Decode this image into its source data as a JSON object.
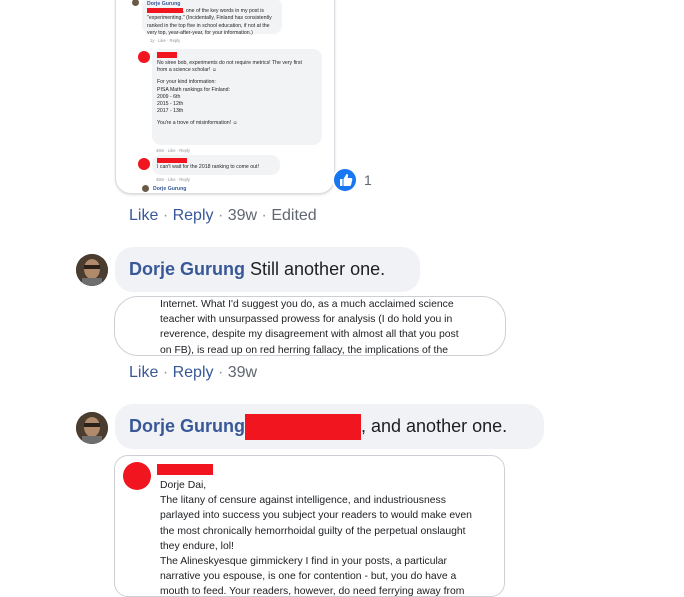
{
  "comment1": {
    "screenshot": {
      "entry1": {
        "name": "Dorje Gurung",
        "text_after_redaction": ", one of the key words in my post is",
        "text_rest": "\"experimenting.\" (Incidentally, Finland has consistently ranked in the top five in school education, if not at the very top, year-after-year, for your information.)",
        "actions": "1y · Like · Reply"
      },
      "entry2": {
        "lines": [
          "No siree bob, experiments do not require metrics! The very first",
          "from a science scholar! ☺",
          "",
          "For your kind information:",
          "PISA Math rankings for Finland:",
          "2009 - 6th",
          "2015 - 12th",
          "2017 - 13th",
          "",
          "You're a trove of misinformation! ☺"
        ],
        "actions": "48m · Like · Reply"
      },
      "entry3": {
        "text": "I can't wait for the 2018 ranking to come out!",
        "actions": "48m · Like · Reply"
      },
      "entry4": {
        "name": "Dorje Gurung"
      }
    },
    "reaction_count": "1",
    "actions": {
      "like": "Like",
      "reply": "Reply",
      "time": "39w",
      "edited": "Edited"
    }
  },
  "comment2": {
    "author": "Dorje Gurung",
    "text": "Still another one.",
    "screenshot_lines": [
      "Internet. What I'd suggest you do, as a much acclaimed science",
      "teacher with unsurpassed prowess for analysis (I do hold you in",
      "reverence, despite my disagreement with almost all that you post",
      "on FB),  is read up on red herring fallacy, the implications of the"
    ],
    "actions": {
      "like": "Like",
      "reply": "Reply",
      "time": "39w"
    }
  },
  "comment3": {
    "author": "Dorje Gurung",
    "text": ", and another one.",
    "screenshot_lines": [
      "Dorje Dai,",
      "The litany of censure against intelligence, and industriousness",
      "parlayed into success you subject your readers to would make even",
      "the most chronically hemorrhoidal guilty of the perpetual onslaught",
      "they endure, lol!",
      "The Alineskyesque gimmickery I find in your posts, a particular",
      "narrative you espouse, is one for contention - but, you do have a",
      "mouth to feed. Your readers, however, do need ferrying away from"
    ]
  },
  "colors": {
    "link": "#385898",
    "redaction": "#f0151f",
    "bubble": "#f0f2f5",
    "like_badge": "#1877f2"
  }
}
